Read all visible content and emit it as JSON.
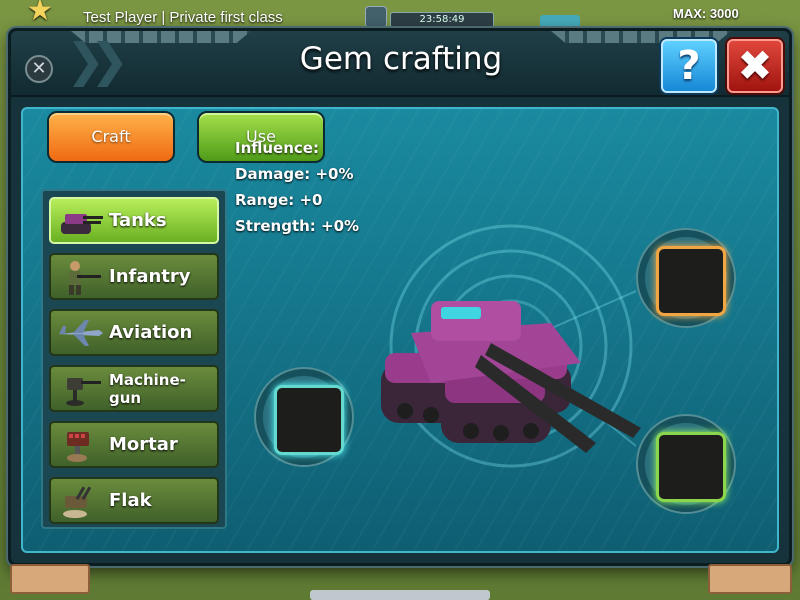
{
  "hud": {
    "player_name": "Test Player | Private first class",
    "timer": "23:58:49",
    "max_label": "MAX: 3000"
  },
  "dialog": {
    "title": "Gem crafting",
    "help_label": "?",
    "close_label": "✖",
    "back_label": "✕"
  },
  "tabs": [
    {
      "label": "Craft",
      "active": true
    },
    {
      "label": "Use",
      "active": false
    }
  ],
  "unit_types": [
    {
      "label": "Tanks",
      "active": true,
      "icon": "tank-icon"
    },
    {
      "label": "Infantry",
      "active": false,
      "icon": "soldier-icon"
    },
    {
      "label": "Aviation",
      "active": false,
      "icon": "jet-icon"
    },
    {
      "label": "Machine-gun",
      "active": false,
      "icon": "machine-gun-icon"
    },
    {
      "label": "Mortar",
      "active": false,
      "icon": "mortar-icon"
    },
    {
      "label": "Flak",
      "active": false,
      "icon": "flak-icon"
    }
  ],
  "stats": {
    "influence": "Influence:",
    "damage": "Damage: +0%",
    "range": "Range: +0",
    "strength": "Strength: +0%"
  },
  "gem_slots": [
    {
      "name": "left",
      "color": "#64d9d0"
    },
    {
      "name": "top",
      "color": "#f0a642"
    },
    {
      "name": "bottom",
      "color": "#8bd64c"
    }
  ],
  "colors": {
    "craft_tab": "#f58a24",
    "use_tab": "#6fba24",
    "help_button": "#1b95e0",
    "close_button": "#c0231a",
    "tank": "#9a3c8c"
  }
}
